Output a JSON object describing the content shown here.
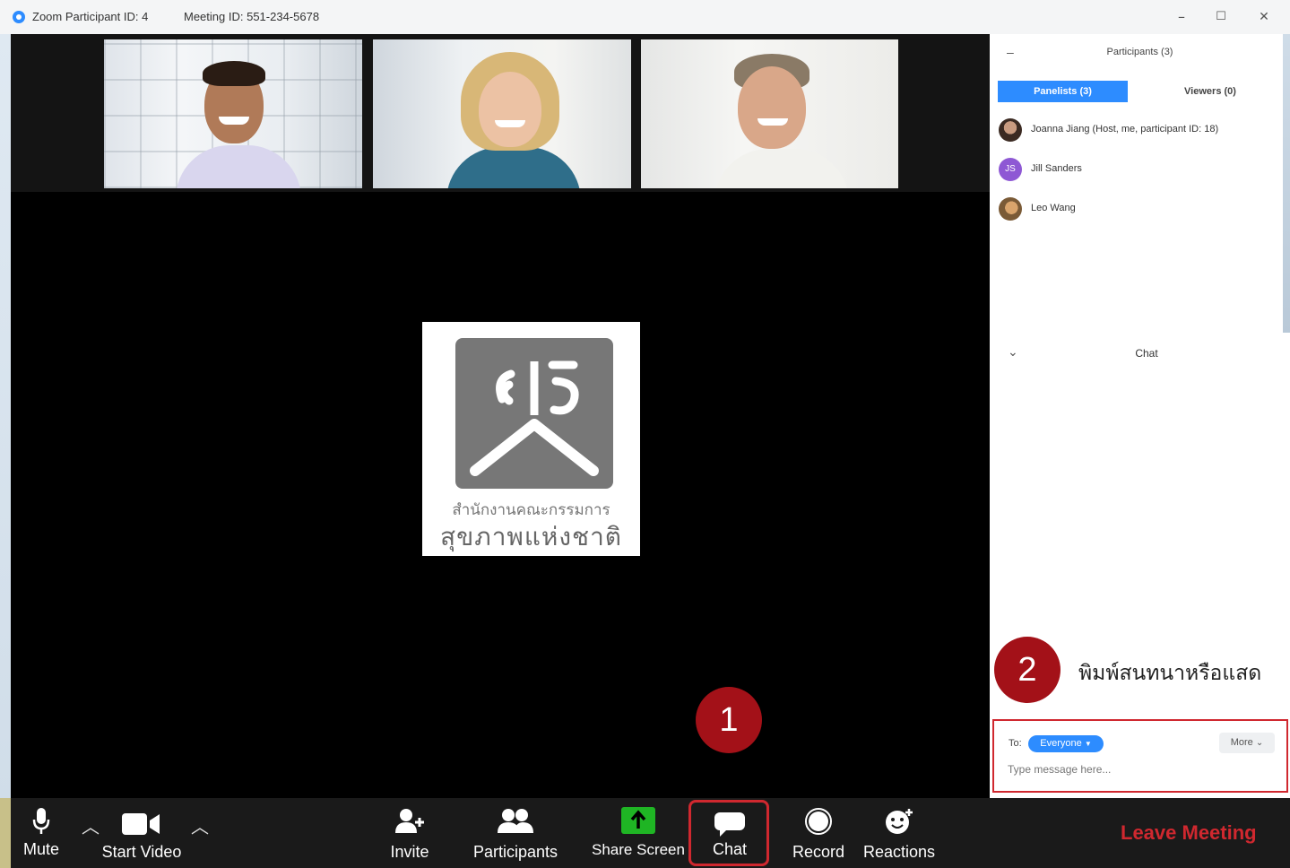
{
  "window": {
    "title": "Zoom Participant ID: 4",
    "meeting_id": "Meeting ID: 551-234-5678",
    "minimize": "–",
    "maximize": "☐",
    "close": "✕"
  },
  "logo_card": {
    "line1": "สำนักงานคณะกรรมการ",
    "line2": "สุขภาพแห่งชาติ"
  },
  "participants_panel": {
    "title": "Participants (3)",
    "tabs": [
      {
        "label": "Panelists (3)",
        "active": true
      },
      {
        "label": "Viewers (0)",
        "active": false
      }
    ],
    "list": [
      {
        "name": "Joanna Jiang (Host, me, participant ID: 18)"
      },
      {
        "name": "Jill Sanders",
        "initials": "JS"
      },
      {
        "name": "Leo Wang"
      }
    ]
  },
  "chat_panel": {
    "title": "Chat",
    "to_label": "To:",
    "recipient": "Everyone",
    "more_label": "More",
    "placeholder": "Type message here..."
  },
  "annotations": {
    "step1": "1",
    "step2": "2",
    "note": "พิมพ์สนทนาหรือแสด"
  },
  "toolbar": {
    "mute": "Mute",
    "start_video": "Start Video",
    "invite": "Invite",
    "participants": "Participants",
    "share_screen": "Share Screen",
    "chat": "Chat",
    "record": "Record",
    "reactions": "Reactions",
    "leave": "Leave Meeting"
  },
  "colors": {
    "accent": "#2d8cff",
    "highlight": "#d0282f",
    "step_badge": "#a31118",
    "share_green": "#1fb524"
  }
}
